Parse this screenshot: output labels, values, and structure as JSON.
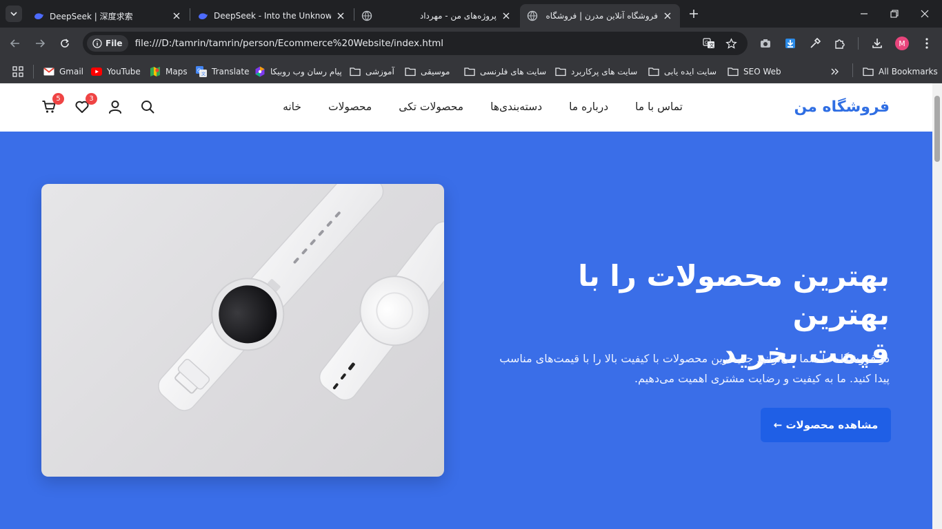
{
  "tabs": [
    {
      "title": "DeepSeek | 深度求索",
      "favicon": "deepseek-whale-icon"
    },
    {
      "title": "DeepSeek - Into the Unknown",
      "favicon": "deepseek-whale-icon"
    },
    {
      "title": "پروژه‌های من - مهرداد",
      "favicon": "globe-icon"
    },
    {
      "title": "فروشگاه آنلاین مدرن | فروشگاه من",
      "favicon": "globe-icon",
      "active": true
    }
  ],
  "address_bar": {
    "scheme_chip": "File",
    "url": "file:///D:/tamrin/tamrin/person/Ecommerce%20Website/index.html"
  },
  "profile_initial": "M",
  "bookmarks": [
    {
      "label": "Gmail",
      "icon": "gmail-icon"
    },
    {
      "label": "YouTube",
      "icon": "youtube-icon"
    },
    {
      "label": "Maps",
      "icon": "maps-icon"
    },
    {
      "label": "Translate",
      "icon": "translate-icon"
    },
    {
      "label": "پیام رسان وب روبیکا",
      "icon": "rubika-icon"
    },
    {
      "label": "آموزشی",
      "icon": "folder-icon"
    },
    {
      "label": "موسیقی",
      "icon": "folder-icon"
    },
    {
      "label": "سایت های فلرنسی",
      "icon": "folder-icon"
    },
    {
      "label": "سایت های پرکاربرد",
      "icon": "folder-icon"
    },
    {
      "label": "سایت ایده یابی",
      "icon": "folder-icon"
    },
    {
      "label": "SEO Web",
      "icon": "folder-icon"
    }
  ],
  "all_bookmarks_label": "All Bookmarks",
  "site": {
    "logo": "فروشگاه من",
    "nav": [
      "خانه",
      "محصولات",
      "محصولات تکی",
      "دسته‌بندی‌ها",
      "درباره ما",
      "تماس با ما"
    ],
    "wishlist_count": "3",
    "cart_count": "5",
    "accent_color": "#3a6ee8",
    "button_color": "#1f5fe6"
  },
  "hero": {
    "title_line1": "بهترین محصولات را با بهترین",
    "title_line2": "قیمت بخرید",
    "description": "در فروشگاه ما شما می‌توانید جدیدترین محصولات با کیفیت بالا را با قیمت‌های مناسب پیدا کنید. ما به کیفیت و رضایت مشتری اهمیت می‌دهیم.",
    "cta_label": "مشاهده محصولات ←",
    "image": "white-smartwatches-photo"
  }
}
